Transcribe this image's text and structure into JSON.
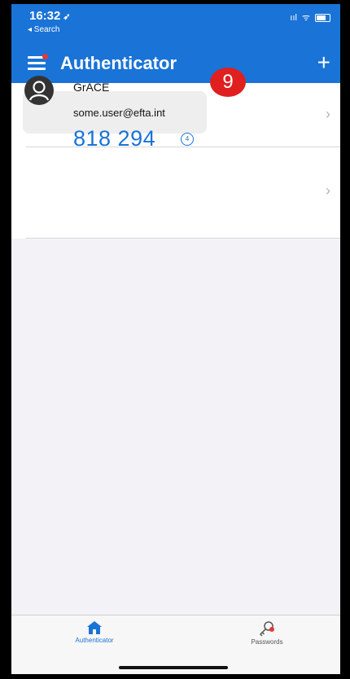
{
  "status": {
    "time": "16:32",
    "location_glyph": "➶",
    "back_app": "◂ Search",
    "signal": "ııl",
    "wifi": "ᯤ"
  },
  "header": {
    "title": "Authenticator",
    "add_glyph": "+"
  },
  "accounts": [
    {
      "name": "",
      "email": "",
      "code": ""
    },
    {
      "name": "GrACE",
      "email": "some.user@efta.int",
      "code": "818 294",
      "seconds_left": "4"
    }
  ],
  "annotation": {
    "step": "9"
  },
  "tabs": [
    {
      "label": "Authenticator",
      "icon": "home-icon",
      "active": true
    },
    {
      "label": "Passwords",
      "icon": "key-icon",
      "active": false
    }
  ],
  "colors": {
    "accent": "#1a73d6",
    "badge": "#e01f1f"
  },
  "chevron": "›"
}
